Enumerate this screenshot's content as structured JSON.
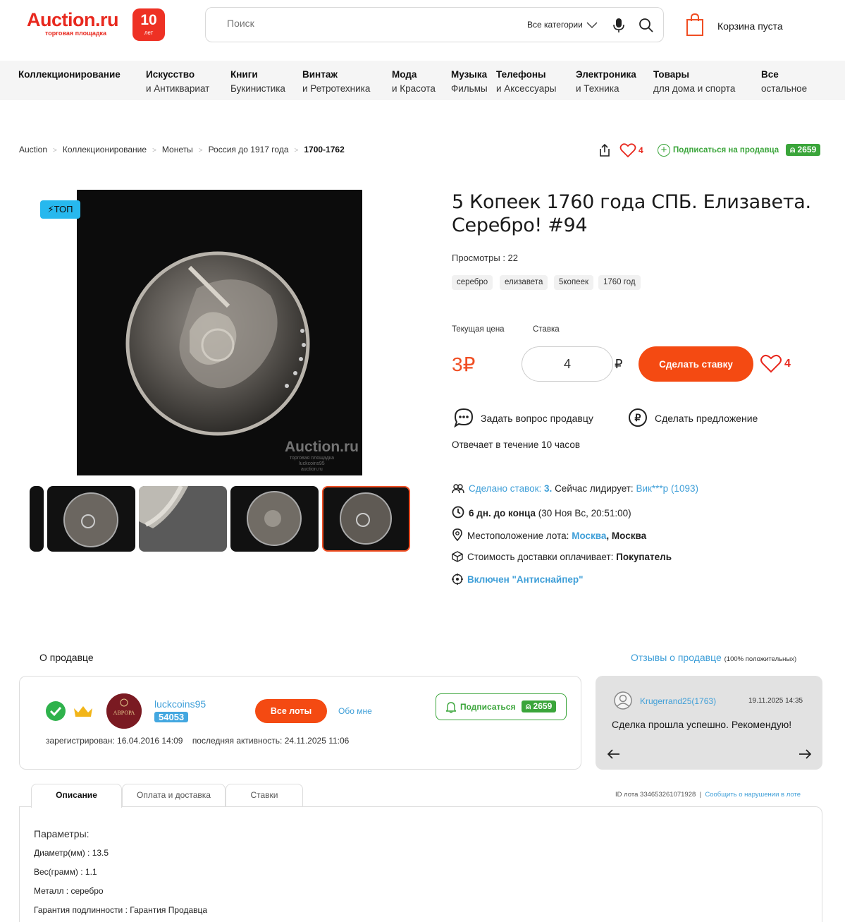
{
  "header": {
    "logo_text": "Auction.ru",
    "logo_sub": "торговая площадка",
    "badge_number": "10",
    "badge_word": "лет",
    "search_placeholder": "Поиск",
    "search_category": "Все категории",
    "cart_text": "Корзина пуста"
  },
  "nav": [
    {
      "bold": "Коллекционирование",
      "sub": ""
    },
    {
      "bold": "Искусство",
      "sub": "и Антиквариат"
    },
    {
      "bold": "Книги",
      "sub": "Букинистика"
    },
    {
      "bold": "Винтаж",
      "sub": "и Ретротехника"
    },
    {
      "bold": "Мода",
      "sub": "и Красота"
    },
    {
      "bold": "Музыка",
      "sub": "Фильмы"
    },
    {
      "bold": "Телефоны",
      "sub": "и Аксессуары"
    },
    {
      "bold": "Электроника",
      "sub": "и Техника"
    },
    {
      "bold": "Товары",
      "sub": "для дома и спорта"
    },
    {
      "bold": "Все",
      "sub": "остальное"
    }
  ],
  "breadcrumb": [
    "Auction",
    "Коллекционирование",
    "Монеты",
    "Россия до 1917 года",
    "1700-1762"
  ],
  "actions": {
    "favorites_count": "4",
    "subscribe_label": "Подписаться на продавца",
    "subscribers_count": "2659"
  },
  "gallery": {
    "top_badge": "ТОП",
    "watermark": "Auction.ru",
    "watermark_sub1": "торговая площадка",
    "watermark_sub2": "luckcoins95",
    "watermark_sub3": "auction.ru"
  },
  "lot": {
    "title": "5 Копеек 1760 года СПБ. Елизавета. Серебро! #94",
    "views": "Просмотры : 22",
    "tags": [
      "серебро",
      "елизавета",
      "5копеек",
      "1760 год"
    ],
    "current_price_label": "Текущая цена",
    "bid_label": "Ставка",
    "price": "3₽",
    "bid_value": "4",
    "currency": "₽",
    "bid_button": "Сделать ставку",
    "likes": "4",
    "ask_seller": "Задать вопрос продавцу",
    "make_offer": "Сделать предложение",
    "reply_time": "Отвечает в течение 10 часов"
  },
  "info": {
    "bids_made": "Сделано ставок:",
    "bids_count": "3.",
    "leader_label": "Сейчас лидирует:",
    "leader": "Вик***р (1093)",
    "time_left": "6 дн. до конца",
    "end_date": "(30 Ноя Вс, 20:51:00)",
    "location_label": "Местоположение лота:",
    "location_city": "Москва",
    "location_region": ", Москва",
    "shipping_label": "Стоимость доставки оплачивает:",
    "shipping_payer": "Покупатель",
    "antisniper": "Включен \"Антиснайпер\""
  },
  "seller": {
    "section_title": "О продавце",
    "reviews_link": "Отзывы о продавце",
    "reviews_note": "(100% положительных)",
    "avatar_text": "АВРОРА",
    "name": "luckcoins95",
    "rating": "54053",
    "all_lots": "Все лоты",
    "about_me": "Обо мне",
    "subscribe": "Подписаться",
    "subscribers": "2659",
    "registered": "зарегистрирован: 16.04.2016 14:09",
    "last_active": "последняя активность: 24.11.2025 11:06"
  },
  "review": {
    "user": "Krugerrand25(1763)",
    "date": "19.11.2025 14:35",
    "text": "Сделка прошла успешно. Рекомендую!"
  },
  "tabs": [
    "Описание",
    "Оплата и доставка",
    "Ставки"
  ],
  "lot_id": "ID лота 334653261071928",
  "report": "Сообщить о нарушении в лоте",
  "params": {
    "title": "Параметры:",
    "items": [
      "Диаметр(мм) : 13.5",
      "Вес(грамм) : 1.1",
      "Металл : серебро",
      "Гарантия подлинности : Гарантия Продавца"
    ]
  }
}
